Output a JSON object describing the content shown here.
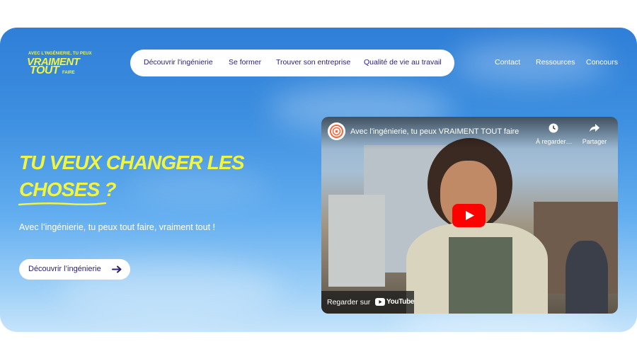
{
  "logo": {
    "line1": "AVEC L'INGÉNIERIE, TU PEUX",
    "line2": "VRAIMENT",
    "line3": "TOUT",
    "line4": "FAIRE"
  },
  "nav": {
    "items": [
      {
        "label": "Découvrir l'ingénierie"
      },
      {
        "label": "Se former"
      },
      {
        "label": "Trouver son entreprise"
      },
      {
        "label": "Qualité de vie au travail"
      }
    ],
    "right": [
      {
        "label": "Contact"
      },
      {
        "label": "Ressources"
      },
      {
        "label": "Concours"
      }
    ]
  },
  "hero": {
    "headline_part1": "TU VEUX CHANGER LES",
    "headline_underlined": "CHOSES",
    "headline_end": " ?",
    "subtitle": "Avec l’ingénierie, tu peux tout faire, vraiment tout !",
    "cta_label": "Découvrir l’ingénierie"
  },
  "video": {
    "title": "Avec l'ingénierie, tu peux VRAIMENT TOUT faire",
    "watch_later": "À regarder…",
    "share": "Partager",
    "watch_on": "Regarder sur",
    "platform": "YouTube"
  },
  "colors": {
    "accent_yellow": "#eff542",
    "nav_text": "#2b1f73",
    "sky_blue": "#3d8fe0",
    "youtube_red": "#ff0000"
  }
}
